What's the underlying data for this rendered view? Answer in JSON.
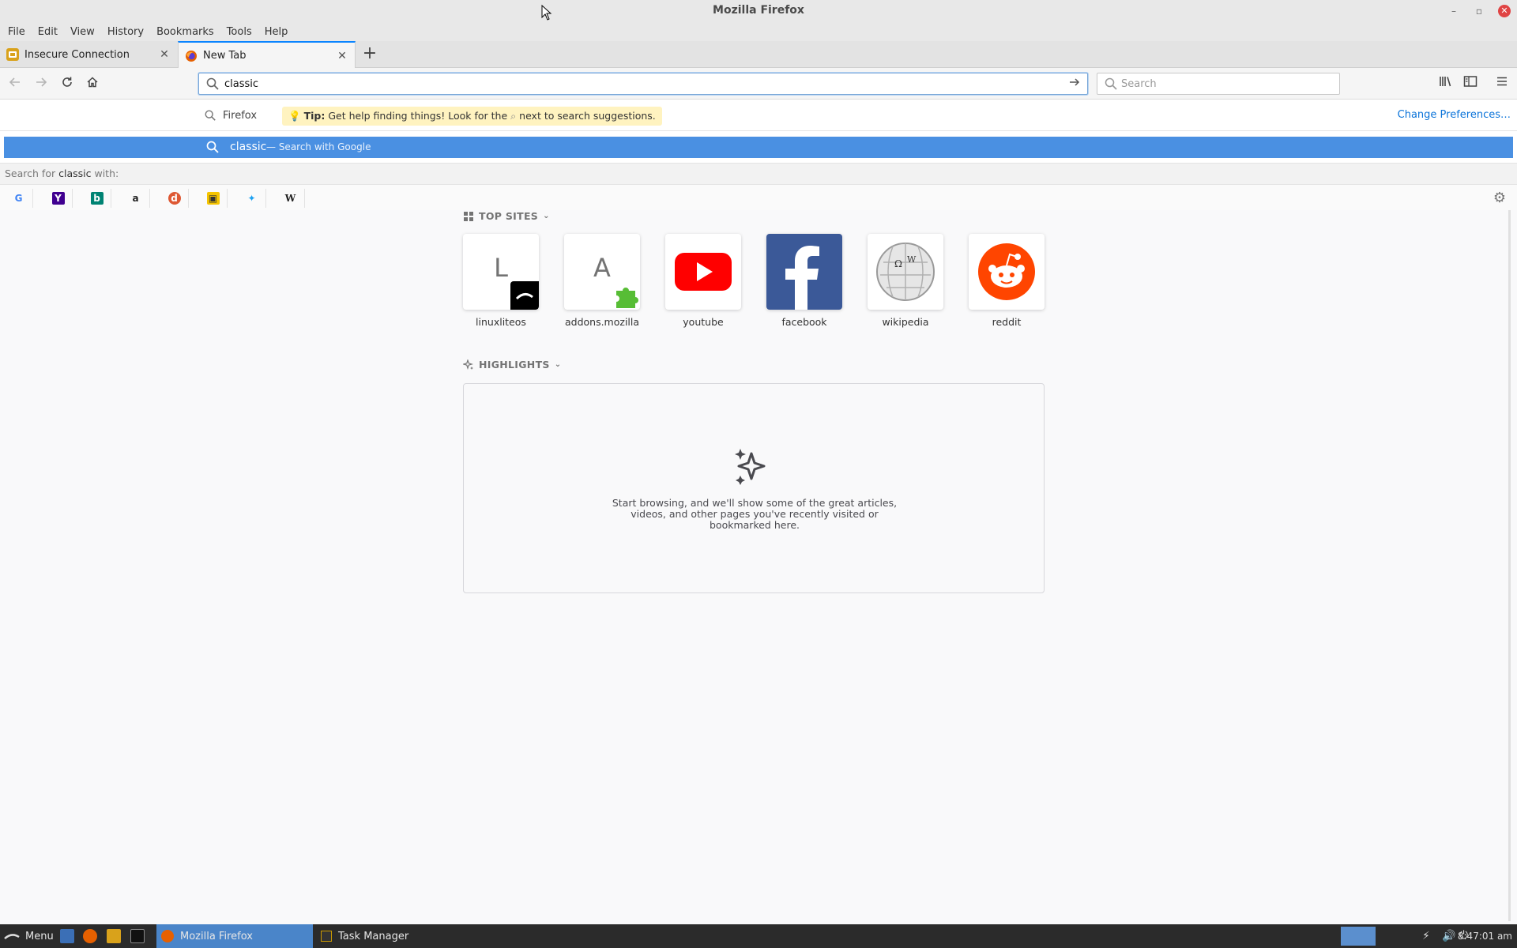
{
  "window": {
    "title": "Mozilla Firefox",
    "controls": [
      "–",
      "▫",
      "✕"
    ]
  },
  "menubar": [
    "File",
    "Edit",
    "View",
    "History",
    "Bookmarks",
    "Tools",
    "Help"
  ],
  "tabs": [
    {
      "label": "Insecure Connection",
      "active": false,
      "favicon": "warning-icon",
      "favicon_color": "#d9a21b"
    },
    {
      "label": "New Tab",
      "active": true,
      "favicon": "firefox-icon",
      "favicon_color": "#e66000"
    }
  ],
  "toolbar": {
    "url_value": "classic",
    "search_placeholder": "Search"
  },
  "dropdown": {
    "engine_label": "Firefox",
    "tip_bold": "Tip:",
    "tip_text": "Get help finding things! Look for the",
    "tip_text2": "next to search suggestions.",
    "change_prefs": "Change Preferences…",
    "selected_query": "classic",
    "selected_hint": "— Search with Google",
    "search_for_prefix": "Search for",
    "search_for_term": "classic",
    "search_for_suffix": "with:",
    "engines": [
      {
        "name": "google-icon",
        "glyph": "G",
        "color": "#4285f4",
        "bg": "transparent"
      },
      {
        "name": "yahoo-icon",
        "glyph": "Y",
        "color": "#ffffff",
        "bg": "#400090"
      },
      {
        "name": "bing-icon",
        "glyph": "b",
        "color": "#ffffff",
        "bg": "#008373"
      },
      {
        "name": "amazon-icon",
        "glyph": "a",
        "color": "#222222",
        "bg": "transparent"
      },
      {
        "name": "duckduckgo-icon",
        "glyph": "◉",
        "color": "#de5833",
        "bg": "transparent"
      },
      {
        "name": "ebay-icon",
        "glyph": "▣",
        "color": "#333333",
        "bg": "#f5c400"
      },
      {
        "name": "twitter-icon",
        "glyph": "✦",
        "color": "#1da1f2",
        "bg": "transparent"
      },
      {
        "name": "wikipedia-icon",
        "glyph": "W",
        "color": "#222222",
        "bg": "transparent"
      }
    ]
  },
  "topsites": {
    "heading": "TOP SITES",
    "sites": [
      {
        "label": "linuxliteos",
        "letter": "L"
      },
      {
        "label": "addons.mozilla",
        "letter": "A"
      },
      {
        "label": "youtube",
        "letter": ""
      },
      {
        "label": "facebook",
        "letter": ""
      },
      {
        "label": "wikipedia",
        "letter": ""
      },
      {
        "label": "reddit",
        "letter": ""
      }
    ]
  },
  "highlights": {
    "heading": "HIGHLIGHTS",
    "message_line1": "Start browsing, and we'll show some of the great articles,",
    "message_line2": "videos, and other pages you've recently visited or",
    "message_line3": "bookmarked here."
  },
  "taskbar": {
    "menu_label": "Menu",
    "task_firefox": "Mozilla Firefox",
    "task_manager": "Task Manager",
    "clock": "8:47:01 am"
  },
  "colors": {
    "accent": "#0a84ff",
    "selection": "#4a90e2",
    "tip_bg": "#fff3c0"
  }
}
